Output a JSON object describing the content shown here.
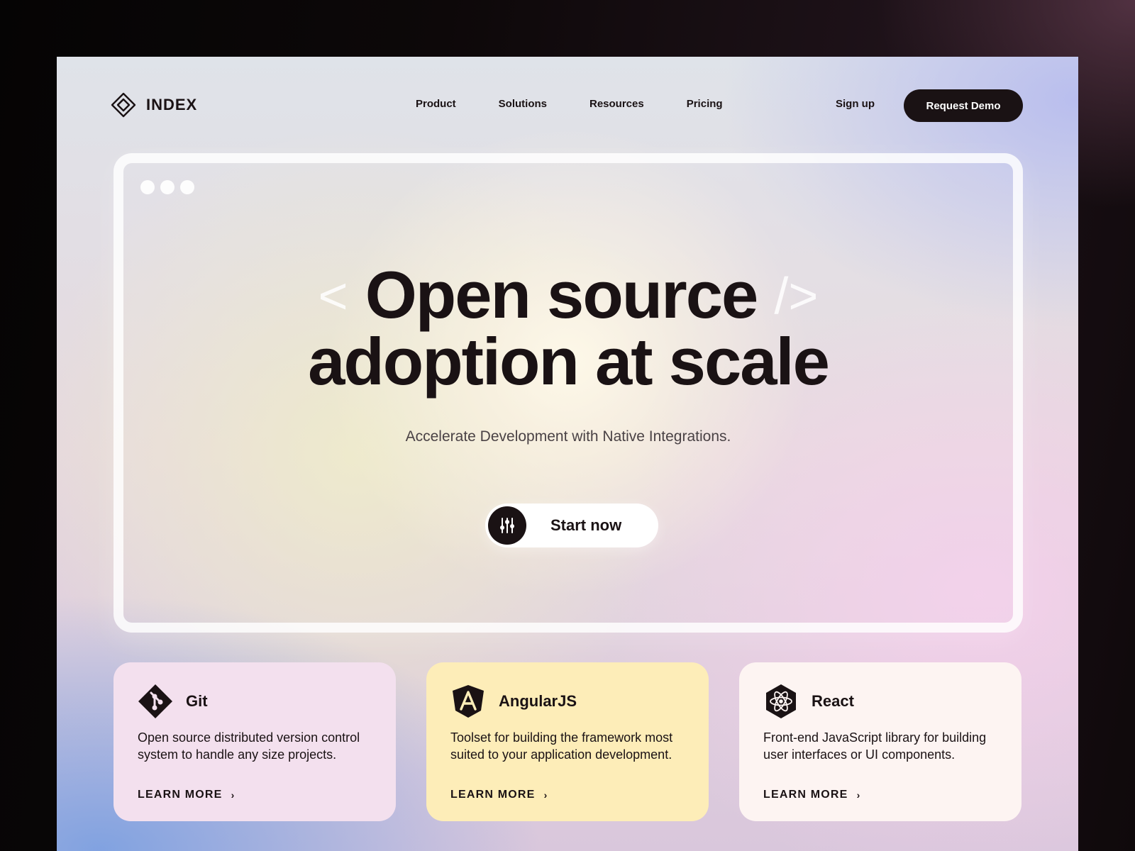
{
  "brand": {
    "name": "INDEX",
    "logo_icon": "diamond-logo-icon",
    "dark_color": "#1a1214"
  },
  "nav": {
    "links": [
      "Product",
      "Solutions",
      "Resources",
      "Pricing"
    ],
    "signup_label": "Sign up",
    "demo_label": "Request Demo"
  },
  "hero": {
    "bracket_open": "<",
    "title_line1": "Open source",
    "bracket_close": "/>",
    "title_line2": "adoption at scale",
    "subtitle": "Accelerate Development with Native Integrations.",
    "cta_label": "Start now",
    "cta_icon": "sliders-icon"
  },
  "cards": [
    {
      "title": "Git",
      "icon": "git-icon",
      "description": "Open source distributed version control system to handle any size projects.",
      "link_label": "LEARN MORE",
      "bg_color": "#f3e0ee"
    },
    {
      "title": "AngularJS",
      "icon": "angular-icon",
      "description": "Toolset for building the framework most suited to your application development.",
      "link_label": "LEARN MORE",
      "bg_color": "#fdedb8"
    },
    {
      "title": "React",
      "icon": "react-icon",
      "description": "Front-end JavaScript library for building user interfaces or UI components.",
      "link_label": "LEARN MORE",
      "bg_color": "#fdf4f2"
    }
  ]
}
